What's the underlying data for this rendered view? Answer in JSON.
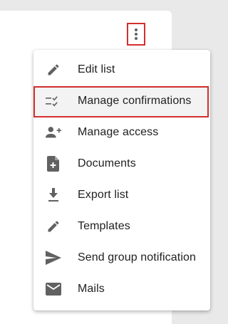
{
  "menu": {
    "items": [
      {
        "label": "Edit list",
        "icon": "pencil-icon"
      },
      {
        "label": "Manage confirmations",
        "icon": "checklist-icon",
        "selected": true
      },
      {
        "label": "Manage access",
        "icon": "person-add-icon"
      },
      {
        "label": "Documents",
        "icon": "note-add-icon"
      },
      {
        "label": "Export list",
        "icon": "download-icon"
      },
      {
        "label": "Templates",
        "icon": "pencil-icon"
      },
      {
        "label": "Send group notification",
        "icon": "send-icon"
      },
      {
        "label": "Mails",
        "icon": "mail-icon"
      }
    ]
  },
  "colors": {
    "highlight_border": "#d32f2f",
    "icon": "#616161",
    "text": "#212121",
    "selected_bg": "#f3f3f3"
  }
}
